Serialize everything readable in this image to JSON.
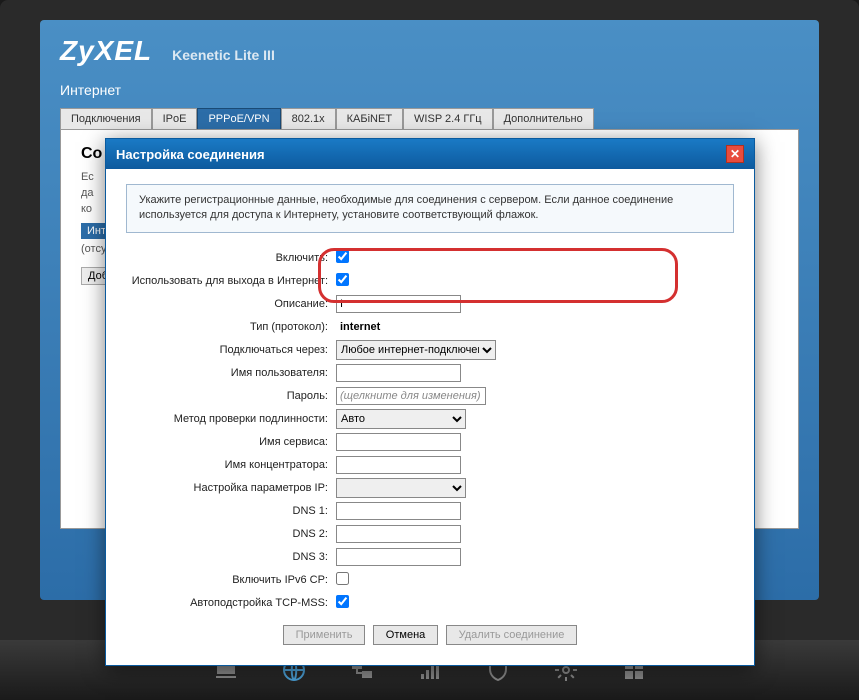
{
  "brand": "ZyXEL",
  "model": "Keenetic Lite III",
  "section": "Интернет",
  "tabs": [
    "Подключения",
    "IPoE",
    "PPPoE/VPN",
    "802.1x",
    "КАБiNET",
    "WISP 2.4 ГГц",
    "Дополнительно"
  ],
  "bg_panel": {
    "title_frag": "Со",
    "line1": "Ес",
    "line2": "да",
    "line3": "ко",
    "btn_frag": "Инт",
    "paren": "(отсу",
    "add_btn_frag": "Доба"
  },
  "modal": {
    "title": "Настройка соединения",
    "info": "Укажите регистрационные данные, необходимые для соединения с сервером. Если данное соединение используется для доступа к Интернету, установите соответствующий флажок.",
    "fields": {
      "enable": "Включить:",
      "use_internet": "Использовать для выхода в Интернет:",
      "description": "Описание:",
      "description_val": "I",
      "type": "Тип (протокол):",
      "type_val": "internet",
      "connect_via": "Подключаться через:",
      "connect_via_val": "Любое интернет-подключение",
      "username": "Имя пользователя:",
      "password": "Пароль:",
      "password_placeholder": "(щелкните для изменения)",
      "auth_method": "Метод проверки подлинности:",
      "auth_method_val": "Авто",
      "service_name": "Имя сервиса:",
      "concentrator": "Имя концентратора:",
      "ip_settings": "Настройка параметров IP:",
      "dns1": "DNS 1:",
      "dns2": "DNS 2:",
      "dns3": "DNS 3:",
      "ipv6cp": "Включить IPv6 CP:",
      "tcpmss": "Автоподстройка TCP-MSS:"
    },
    "buttons": {
      "apply": "Применить",
      "cancel": "Отмена",
      "delete": "Удалить соединение"
    }
  }
}
